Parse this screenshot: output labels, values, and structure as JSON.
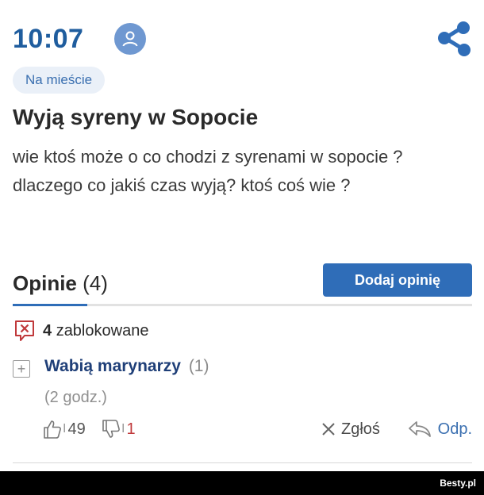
{
  "header": {
    "time": "10:07"
  },
  "badge": "Na mieście",
  "post": {
    "title": "Wyją syreny w Sopocie",
    "body_line1": "wie ktoś może o co chodzi z syrenami w sopocie ?",
    "body_line2": "dlaczego co jakiś czas wyją? ktoś coś wie ?"
  },
  "opinions": {
    "label": "Opinie",
    "count": "(4)",
    "add_label": "Dodaj opinię"
  },
  "blocked": {
    "count": "4",
    "label": "zablokowane"
  },
  "comment": {
    "expand_symbol": "+",
    "author": "Wabią marynarzy",
    "replies": "(1)",
    "time": "(2 godz.)",
    "up_sep": "I",
    "up_votes": "49",
    "down_sep": "I",
    "down_votes": "1",
    "report_label": "Zgłoś",
    "reply_label": "Odp."
  },
  "watermark": "Besty.pl",
  "colors": {
    "accent": "#2f6db8",
    "time": "#1f5d9e",
    "author": "#1f3f78",
    "alert": "#c0393b"
  }
}
